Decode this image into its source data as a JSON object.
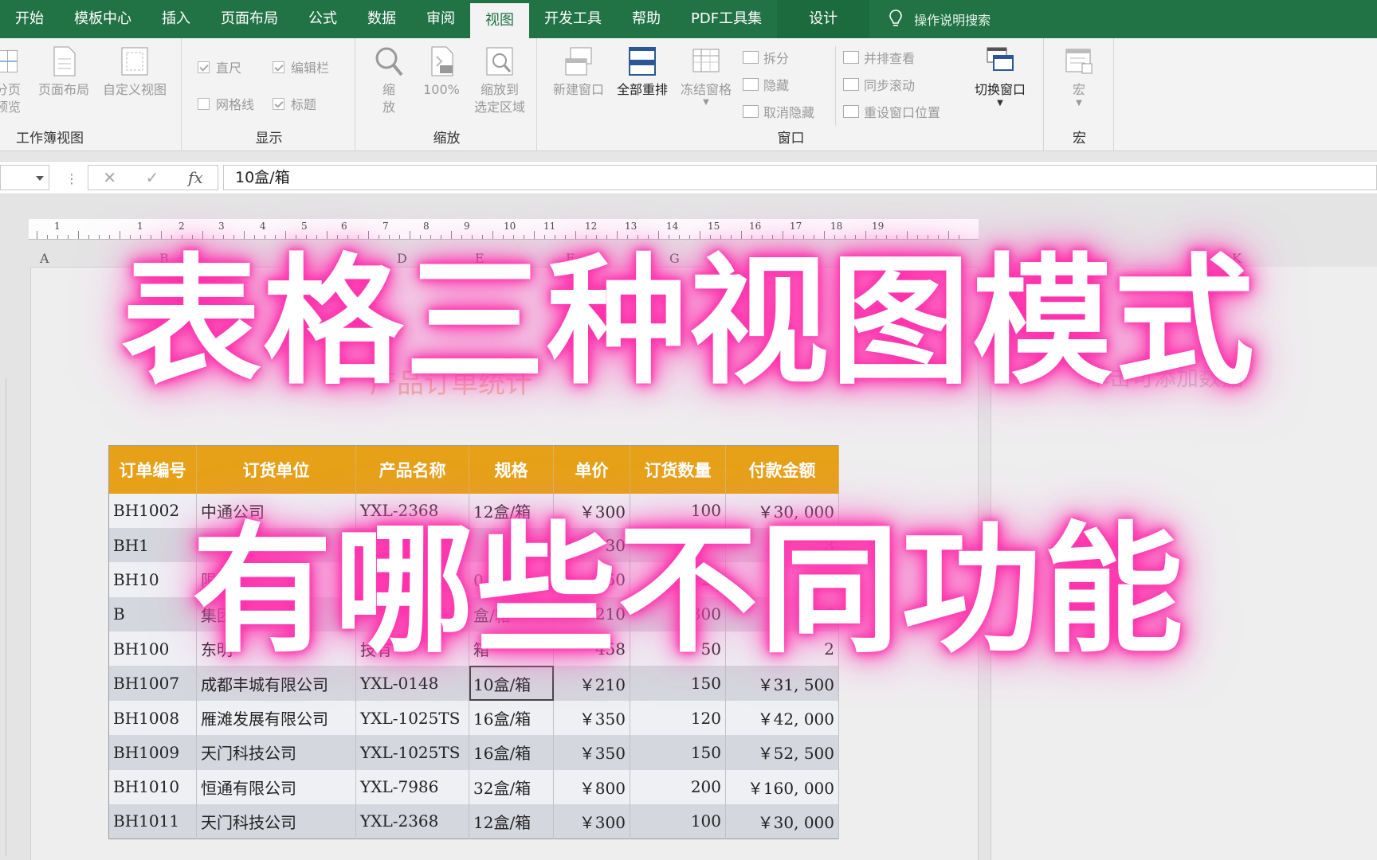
{
  "tabs": [
    "开始",
    "模板中心",
    "插入",
    "页面布局",
    "公式",
    "数据",
    "审阅",
    "视图",
    "开发工具",
    "帮助",
    "PDF工具集",
    "设计"
  ],
  "active_tab_index": 7,
  "tell_me": "操作说明搜索",
  "ribbon": {
    "workbook_views": {
      "label": "工作簿视图",
      "page_break_preview": "分页\n预览",
      "page_layout": "页面布局",
      "custom_views": "自定义视图"
    },
    "show": {
      "label": "显示",
      "ruler": "直尺",
      "formula_bar": "编辑栏",
      "gridlines": "网格线",
      "headings": "标题"
    },
    "zoom": {
      "label": "缩放",
      "zoom": "缩\n放",
      "hundred": "100%",
      "zoom_to_selection": "缩放到\n选定区域"
    },
    "window": {
      "label": "窗口",
      "new_window": "新建窗口",
      "arrange_all": "全部重排",
      "freeze_panes": "冻结窗格",
      "split": "拆分",
      "hide": "隐藏",
      "unhide": "取消隐藏",
      "view_side_by_side": "并排查看",
      "sync_scroll": "同步滚动",
      "reset_position": "重设窗口位置",
      "switch_windows": "切换窗口"
    },
    "macros": {
      "label": "宏",
      "macros": "宏"
    }
  },
  "formula_bar": {
    "cancel": "✕",
    "enter": "✓",
    "fx": "fx",
    "value": "10盒/箱"
  },
  "ruler_numbers": [
    "1",
    "1",
    "2",
    "3",
    "4",
    "5",
    "6",
    "7",
    "8",
    "9",
    "10",
    "11",
    "12",
    "13",
    "14",
    "15",
    "16",
    "17",
    "18",
    "19"
  ],
  "column_headers": [
    "A",
    "B",
    "C",
    "D",
    "E",
    "F",
    "G",
    "H",
    "I",
    "K"
  ],
  "sheet": {
    "table_title": "产品订单统计",
    "add_data_hint": "单击可添加数据",
    "headers": [
      "订单编号",
      "订货单位",
      "产品名称",
      "规格",
      "单价",
      "订货数量",
      "付款金额"
    ],
    "rows": [
      [
        "BH1002",
        "中通公司",
        "YXL-2368",
        "12盒/箱",
        "￥300",
        "100",
        "￥30, 000"
      ],
      [
        "BH1",
        "",
        "",
        "",
        "30",
        "",
        "3"
      ],
      [
        "BH10",
        "限公",
        "",
        "0 箱",
        "50",
        "20",
        "￥13"
      ],
      [
        "B",
        "集团",
        "",
        "盒/箱",
        "210",
        "300",
        "6"
      ],
      [
        "BH100",
        "东明",
        "技有",
        "箱",
        "458",
        "50",
        "2"
      ],
      [
        "BH1007",
        "成都丰城有限公司",
        "YXL-0148",
        "10盒/箱",
        "￥210",
        "150",
        "￥31, 500"
      ],
      [
        "BH1008",
        "雁滩发展有限公司",
        "YXL-1025TS",
        "16盒/箱",
        "￥350",
        "120",
        "￥42, 000"
      ],
      [
        "BH1009",
        "天门科技公司",
        "YXL-1025TS",
        "16盒/箱",
        "￥350",
        "150",
        "￥52, 500"
      ],
      [
        "BH1010",
        "恒通有限公司",
        "YXL-7986",
        "32盒/箱",
        "￥800",
        "200",
        "￥160, 000"
      ],
      [
        "BH1011",
        "天门科技公司",
        "YXL-2368",
        "12盒/箱",
        "￥300",
        "100",
        "￥30, 000"
      ]
    ]
  },
  "headline": {
    "line1": "表格三种视图模式",
    "line2": "有哪些不同功能"
  },
  "colors": {
    "ribbon_green": "#217346",
    "header_orange": "#e6a118",
    "glow_pink": "#ff2aa8"
  }
}
